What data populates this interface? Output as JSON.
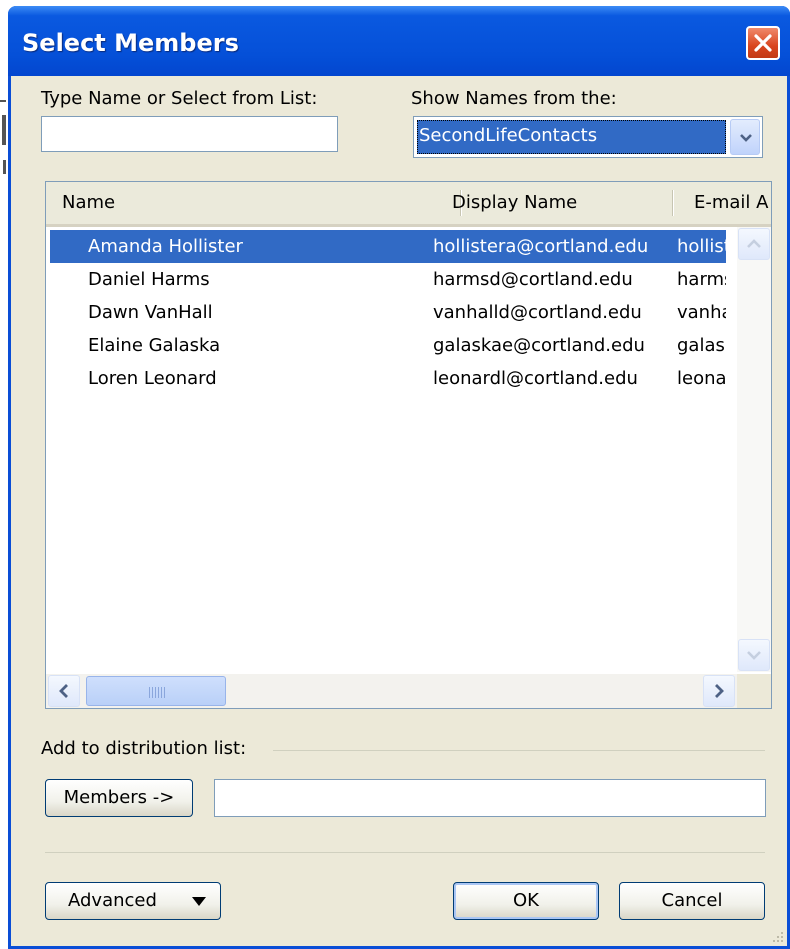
{
  "dialog": {
    "title": "Select Members",
    "close_icon": "close-icon"
  },
  "search": {
    "label": "Type Name or Select from List:",
    "value": "",
    "placeholder": ""
  },
  "address_book": {
    "label": "Show Names from the:",
    "selected": "SecondLifeContacts"
  },
  "list": {
    "columns": [
      "Name",
      "Display Name",
      "E-mail A"
    ],
    "rows": [
      {
        "name": "Amanda Hollister",
        "display": "hollistera@cortland.edu",
        "email": "hollist"
      },
      {
        "name": "Daniel Harms",
        "display": "harmsd@cortland.edu",
        "email": "harms"
      },
      {
        "name": "Dawn VanHall",
        "display": "vanhalld@cortland.edu",
        "email": "vanha"
      },
      {
        "name": "Elaine Galaska",
        "display": "galaskae@cortland.edu",
        "email": "galask"
      },
      {
        "name": "Loren Leonard",
        "display": "leonardl@cortland.edu",
        "email": "leonar"
      }
    ],
    "selected_row": 0
  },
  "distribution": {
    "label": "Add to distribution list:",
    "members_button": "Members ->",
    "members_value": ""
  },
  "footer": {
    "advanced_button": "Advanced",
    "ok_button": "OK",
    "cancel_button": "Cancel"
  },
  "colors": {
    "title_blue": "#0550d8",
    "selection": "#316ac5",
    "dialog_face": "#ece9d8"
  }
}
